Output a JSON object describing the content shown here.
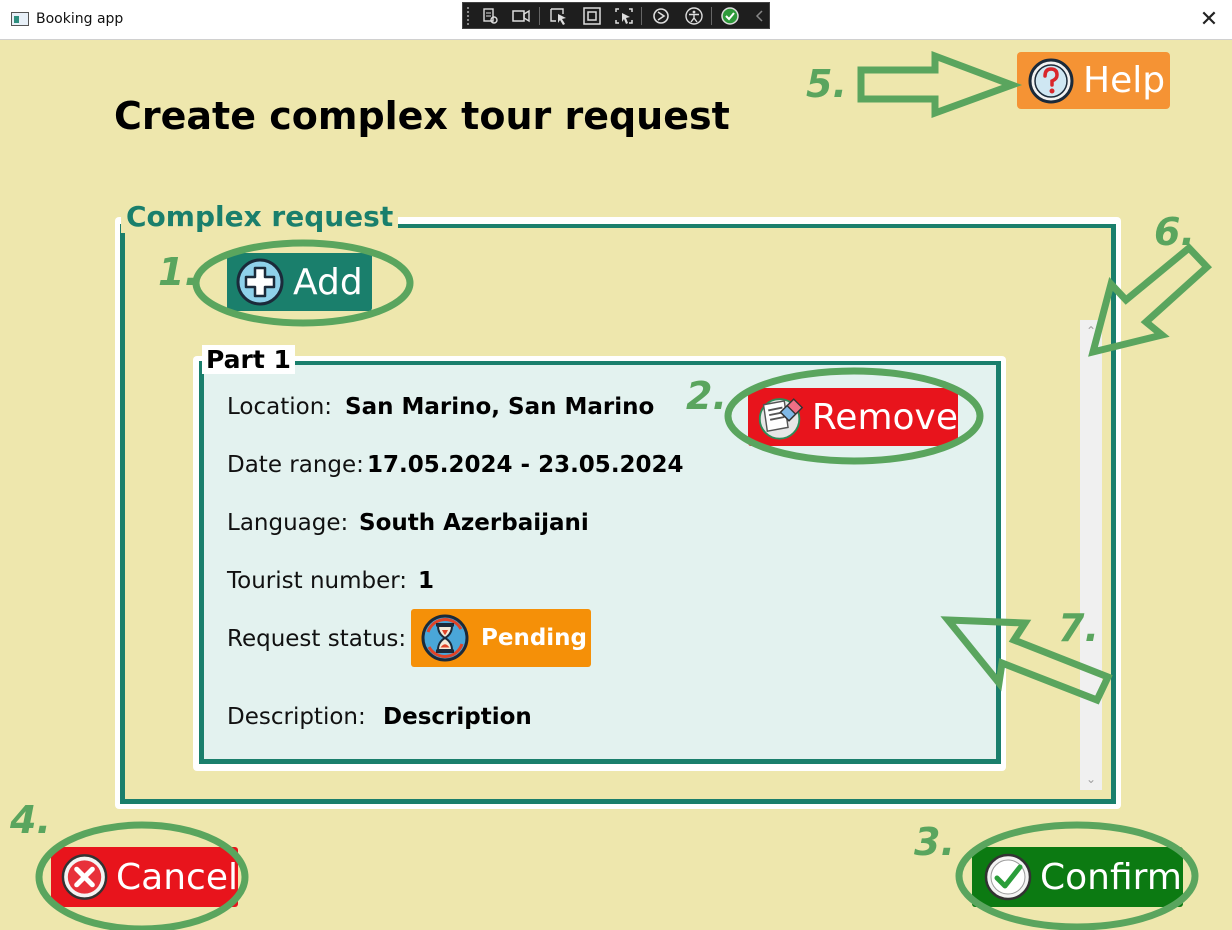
{
  "window": {
    "title": "Booking app",
    "close_glyph": "✕"
  },
  "page": {
    "title": "Create complex tour request"
  },
  "help": {
    "label": "Help",
    "icon": "question-icon",
    "color": "#f59334"
  },
  "complex_request": {
    "legend": "Complex request",
    "add_label": "Add",
    "parts": [
      {
        "legend": "Part 1",
        "location_label": "Location:",
        "location_value": "San Marino, San Marino",
        "date_label": "Date range:",
        "date_value": "17.05.2024 - 23.05.2024",
        "language_label": "Language:",
        "language_value": "South Azerbaijani",
        "tourists_label": "Tourist number:",
        "tourists_value": "1",
        "status_label": "Request status:",
        "status_value": "Pending",
        "description_label": "Description:",
        "description_value": "Description",
        "remove_label": "Remove"
      }
    ]
  },
  "footer": {
    "cancel_label": "Cancel",
    "confirm_label": "Confirm"
  },
  "annotations": {
    "n1": "1.",
    "n2": "2.",
    "n3": "3.",
    "n4": "4.",
    "n5": "5.",
    "n6": "6.",
    "n7": "7."
  },
  "colors": {
    "background": "#eee7ad",
    "accent": "#1a7f6c",
    "danger": "#e8141c",
    "success": "#0c7a12",
    "warning": "#f59008",
    "annotation": "#5aa55e"
  }
}
